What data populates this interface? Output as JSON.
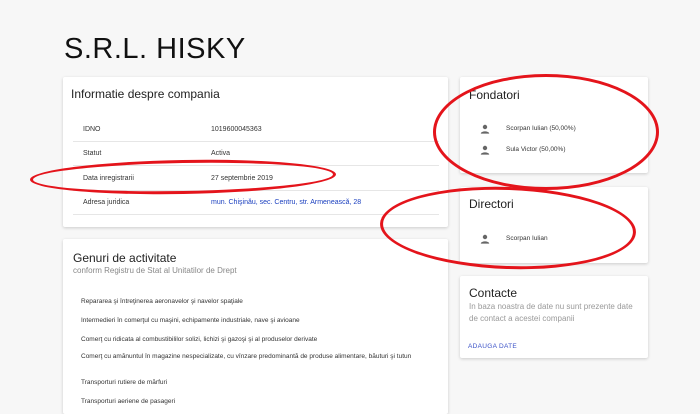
{
  "page": {
    "title": "S.R.L. HISKY"
  },
  "company_info": {
    "title": "Informatie despre compania",
    "rows": [
      {
        "label": "IDNO",
        "value": "1019600045363"
      },
      {
        "label": "Statut",
        "value": "Activa"
      },
      {
        "label": "Data inregistrarii",
        "value": "27 septembrie 2019"
      },
      {
        "label": "Adresa juridica",
        "value": "mun. Chişinău, sec. Centru, str. Armenească, 28"
      }
    ]
  },
  "activities": {
    "title": "Genuri de activitate",
    "subtitle": "conform Registru de Stat al Unitatilor de Drept",
    "items": [
      "Repararea şi întreţinerea aeronavelor şi navelor spaţiale",
      "Intermedieri în comerţul cu maşini, echipamente industriale, nave şi avioane",
      "Comerţ cu ridicata al combustibililor solizi, lichizi şi gazoşi şi al produselor derivate",
      "Comerţ cu amănuntul în magazine nespecializate, cu vînzare predominantă de produse alimentare, băuturi şi tutun",
      "Transporturi rutiere de mărfuri",
      "Transporturi aeriene de pasageri"
    ]
  },
  "founders": {
    "title": "Fondatori",
    "people": [
      {
        "name": "Scorpan Iulian (50,00%)"
      },
      {
        "name": "Sula Victor (50,00%)"
      }
    ]
  },
  "directors": {
    "title": "Directori",
    "people": [
      {
        "name": "Scorpan Iulian"
      }
    ]
  },
  "contacts": {
    "title": "Contacte",
    "note": "In baza noastra de date nu sunt prezente date de contact a acestei companii",
    "add_label": "ADAUGA DATE"
  },
  "colors": {
    "annotation": "#e4141b",
    "link": "#1a3fbf",
    "accent": "#3a51c7"
  },
  "icons": {
    "person": "person-icon"
  }
}
